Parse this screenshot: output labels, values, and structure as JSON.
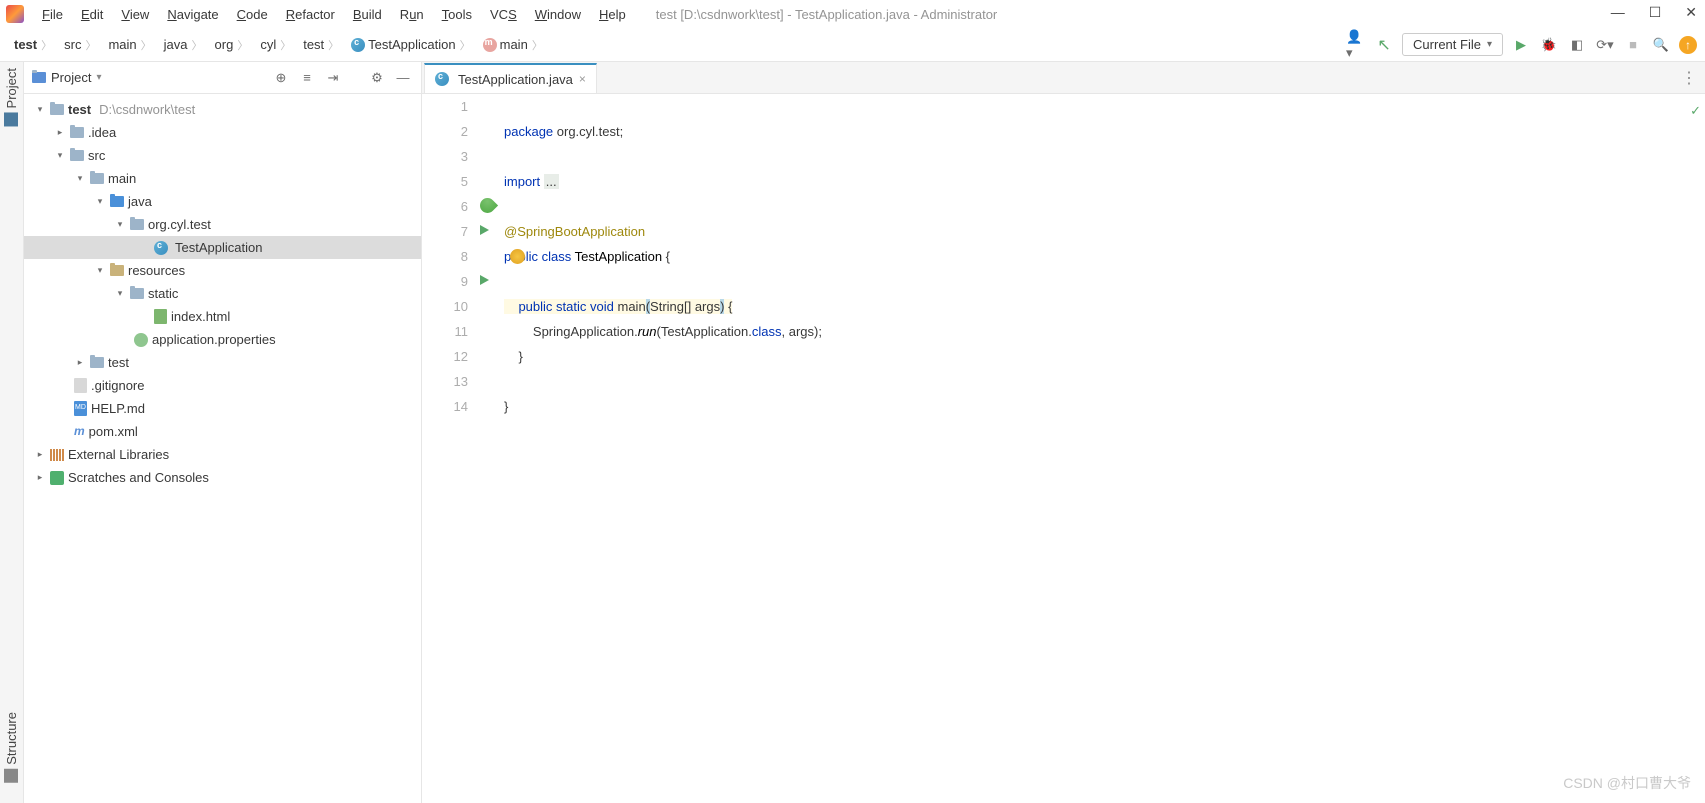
{
  "menu": {
    "file": "File",
    "edit": "Edit",
    "view": "View",
    "navigate": "Navigate",
    "code": "Code",
    "refactor": "Refactor",
    "build": "Build",
    "run": "Run",
    "tools": "Tools",
    "vcs": "VCS",
    "window": "Window",
    "help": "Help"
  },
  "title": "test [D:\\csdnwork\\test] - TestApplication.java - Administrator",
  "breadcrumbs": [
    "test",
    "src",
    "main",
    "java",
    "org",
    "cyl",
    "test",
    "TestApplication",
    "main"
  ],
  "run_config_label": "Current File",
  "project_panel_title": "Project",
  "tree": {
    "root": {
      "name": "test",
      "path": "D:\\csdnwork\\test"
    },
    "idea": ".idea",
    "src": "src",
    "main": "main",
    "java": "java",
    "pkg": "org.cyl.test",
    "cls": "TestApplication",
    "resources": "resources",
    "static": "static",
    "index": "index.html",
    "appprops": "application.properties",
    "testdir": "test",
    "gitignore": ".gitignore",
    "helpmd": "HELP.md",
    "pom": "pom.xml",
    "extlib": "External Libraries",
    "scratch": "Scratches and Consoles"
  },
  "rail": {
    "project": "Project",
    "structure": "Structure"
  },
  "tab_name": "TestApplication.java",
  "code_lines": {
    "l1": {
      "n": "1"
    },
    "l2": {
      "n": "2"
    },
    "l3": {
      "n": "3"
    },
    "l5": {
      "n": "5"
    },
    "l6": {
      "n": "6"
    },
    "l7": {
      "n": "7"
    },
    "l8": {
      "n": "8"
    },
    "l9": {
      "n": "9"
    },
    "l10": {
      "n": "10"
    },
    "l11": {
      "n": "11"
    },
    "l12": {
      "n": "12"
    },
    "l13": {
      "n": "13"
    },
    "l14": {
      "n": "14"
    }
  },
  "code": {
    "pkg_kw": "package",
    "pkg": " org.cyl.test;",
    "imp_kw": "import",
    "imp_fold": "...",
    "anno": "@SpringBootApplication",
    "pub": "public",
    "cls_kw": "class",
    "cls_name": "TestApplication",
    "brace_o": " {",
    "static": "static",
    "void": "void",
    "main": "main",
    "args_open": "(",
    "args": "String[] args",
    "args_close": ")",
    "run_call": "SpringApplication.",
    "run_m": "run",
    "run_rest": "(TestApplication.",
    "class_kw": "class",
    "run_tail": ", args);",
    "close1": "}",
    "close2": "}"
  },
  "watermark": "CSDN @村口曹大爷"
}
